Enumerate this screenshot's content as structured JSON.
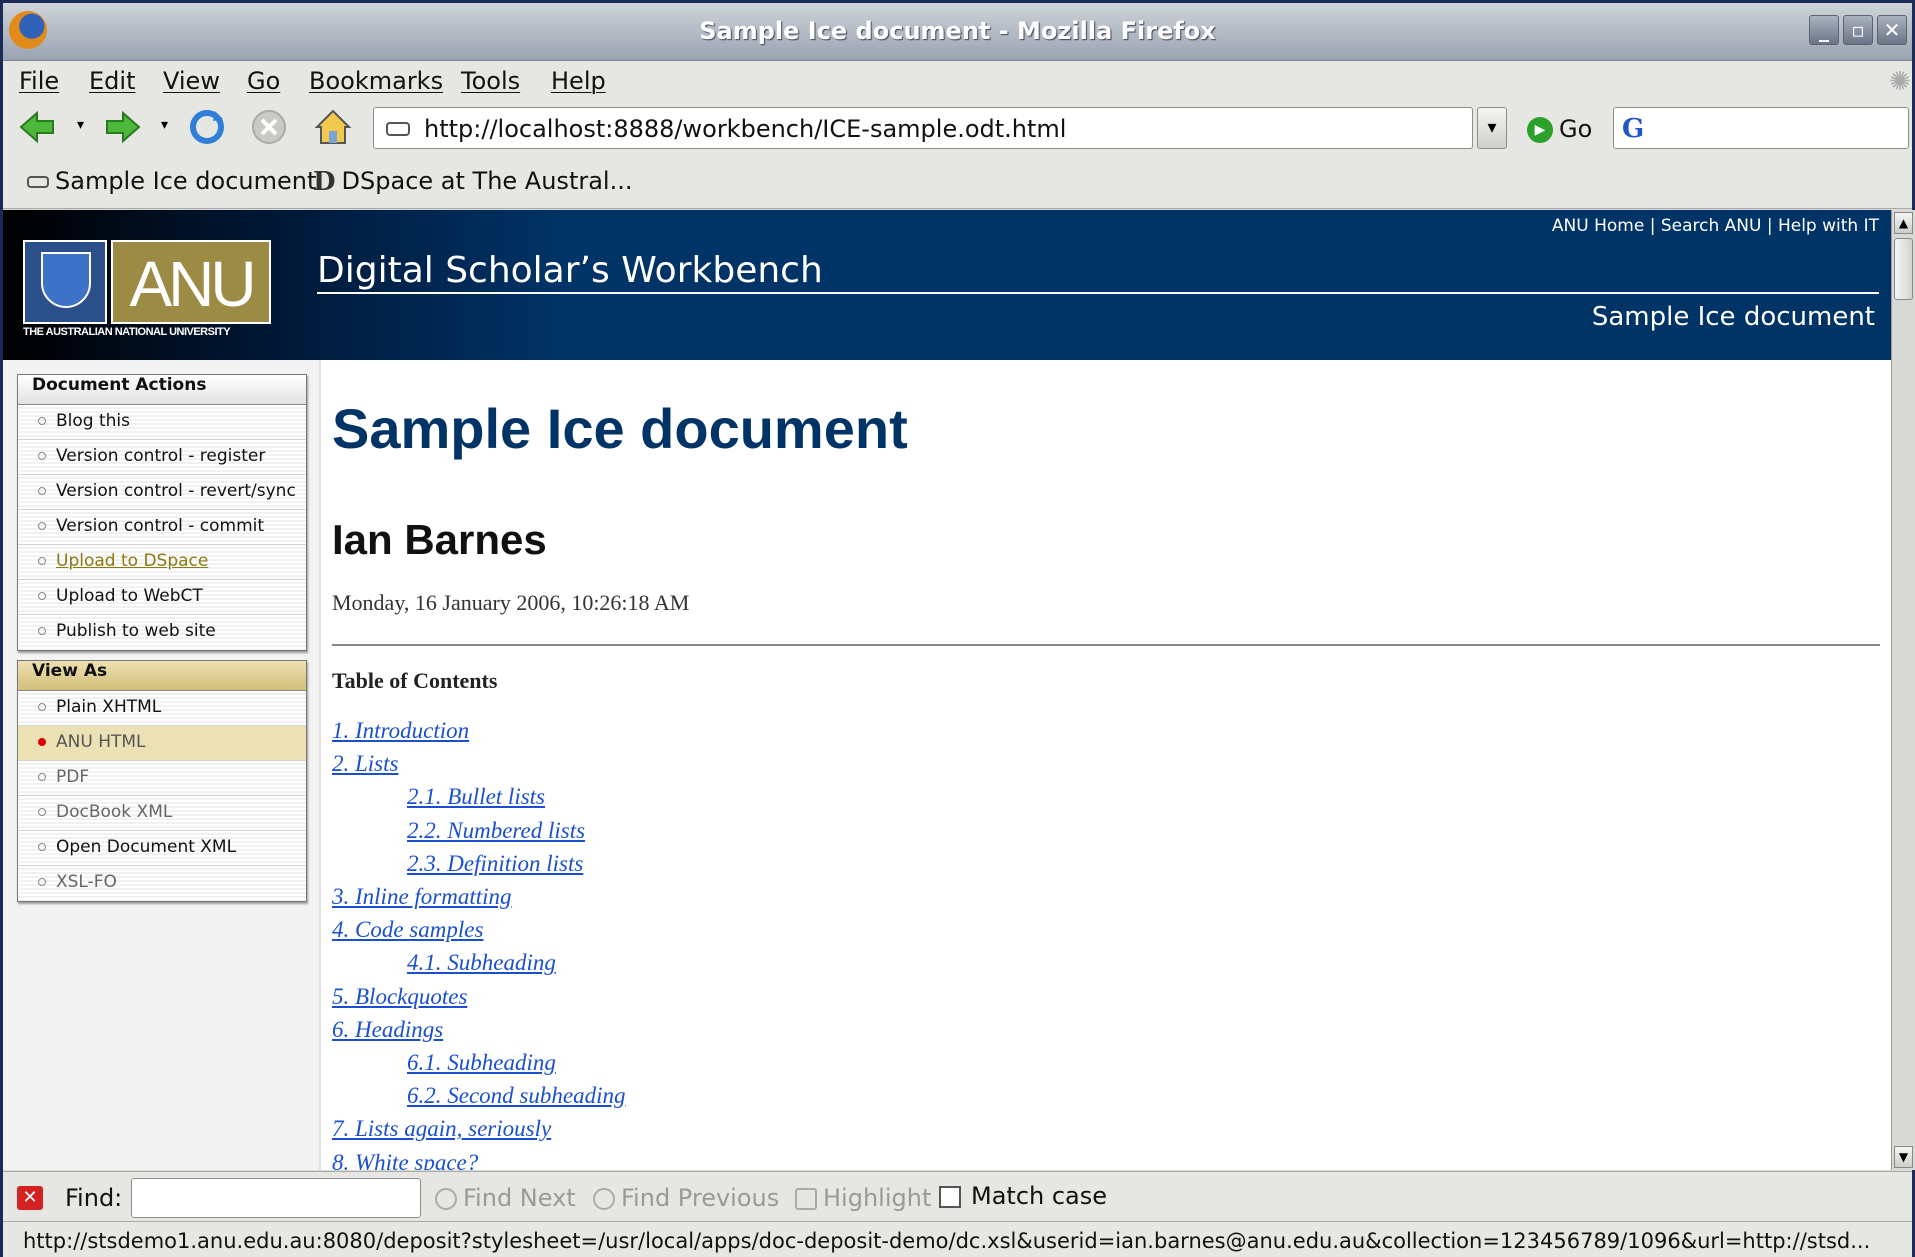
{
  "window": {
    "title": "Sample Ice document - Mozilla Firefox"
  },
  "menu": [
    "File",
    "Edit",
    "View",
    "Go",
    "Bookmarks",
    "Tools",
    "Help"
  ],
  "toolbar": {
    "url": "http://localhost:8888/workbench/ICE-sample.odt.html",
    "go_label": "Go",
    "search_value": ""
  },
  "bookmarks": [
    "Sample Ice document",
    "DSpace at The Austral..."
  ],
  "banner": {
    "logo_text": "ANU",
    "logo_subtitle": "THE AUSTRALIAN NATIONAL UNIVERSITY",
    "site_title": "Digital Scholar’s Workbench",
    "top_links": "ANU Home | Search ANU | Help with IT",
    "doc_title": "Sample Ice document"
  },
  "sidebar": {
    "actions_title": "Document Actions",
    "actions": [
      "Blog this",
      "Version control - register",
      "Version control - revert/sync",
      "Version control - commit",
      "Upload to DSpace",
      "Upload to WebCT",
      "Publish to web site"
    ],
    "view_title": "View As",
    "views": [
      "Plain XHTML",
      "ANU HTML",
      "PDF",
      "DocBook XML",
      "Open Document XML",
      "XSL-FO"
    ]
  },
  "document": {
    "title": "Sample Ice document",
    "author": "Ian Barnes",
    "date": "Monday, 16 January 2006, 10:26:18 AM",
    "toc_heading": "Table of Contents",
    "toc": [
      {
        "label": "1. Introduction",
        "level": 1
      },
      {
        "label": "2. Lists",
        "level": 1
      },
      {
        "label": "2.1. Bullet lists",
        "level": 2
      },
      {
        "label": "2.2. Numbered lists",
        "level": 2
      },
      {
        "label": "2.3. Definition lists",
        "level": 2
      },
      {
        "label": "3. Inline formatting",
        "level": 1
      },
      {
        "label": "4. Code samples",
        "level": 1
      },
      {
        "label": "4.1. Subheading",
        "level": 2
      },
      {
        "label": "5. Blockquotes",
        "level": 1
      },
      {
        "label": "6. Headings",
        "level": 1
      },
      {
        "label": "6.1. Subheading",
        "level": 2
      },
      {
        "label": "6.2. Second subheading",
        "level": 2
      },
      {
        "label": "7. Lists again, seriously",
        "level": 1
      },
      {
        "label": "8. White space?",
        "level": 1
      }
    ]
  },
  "findbar": {
    "label": "Find:",
    "value": "",
    "find_next": "Find Next",
    "find_previous": "Find Previous",
    "highlight": "Highlight",
    "match_case": "Match case"
  },
  "status": "http://stsdemo1.anu.edu.au:8080/deposit?stylesheet=/usr/local/apps/doc-deposit-demo/dc.xsl&userid=ian.barnes@anu.edu.au&collection=123456789/1096&url=http://stsd..."
}
